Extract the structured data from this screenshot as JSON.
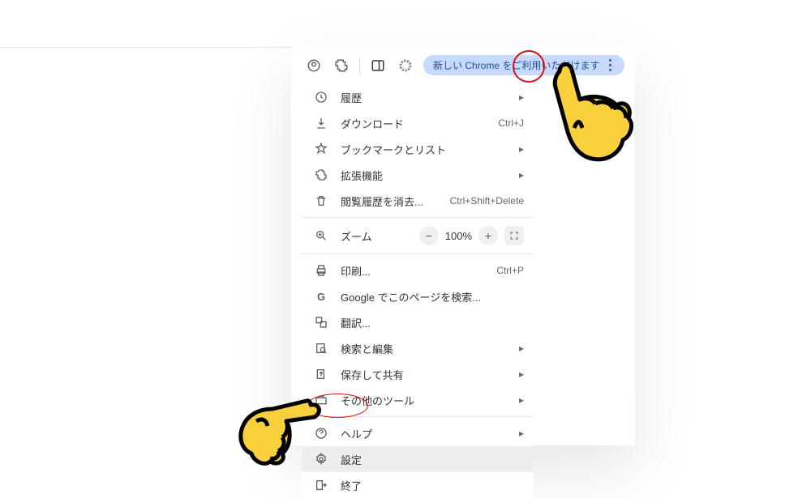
{
  "toolbar": {
    "chip": "新しい Chrome をご利用いただけます"
  },
  "menu": {
    "history": "履歴",
    "downloads": "ダウンロード",
    "downloads_sc": "Ctrl+J",
    "bookmarks": "ブックマークとリスト",
    "extensions": "拡張機能",
    "clear": "閲覧履歴を消去...",
    "clear_sc": "Ctrl+Shift+Delete",
    "zoom_label": "ズーム",
    "zoom_value": "100%",
    "print": "印刷...",
    "print_sc": "Ctrl+P",
    "gsearch": "Google でこのページを検索...",
    "translate": "翻訳...",
    "find": "検索と編集",
    "save_share": "保存して共有",
    "more_tools": "その他のツール",
    "help": "ヘルプ",
    "settings": "設定",
    "exit": "終了"
  }
}
